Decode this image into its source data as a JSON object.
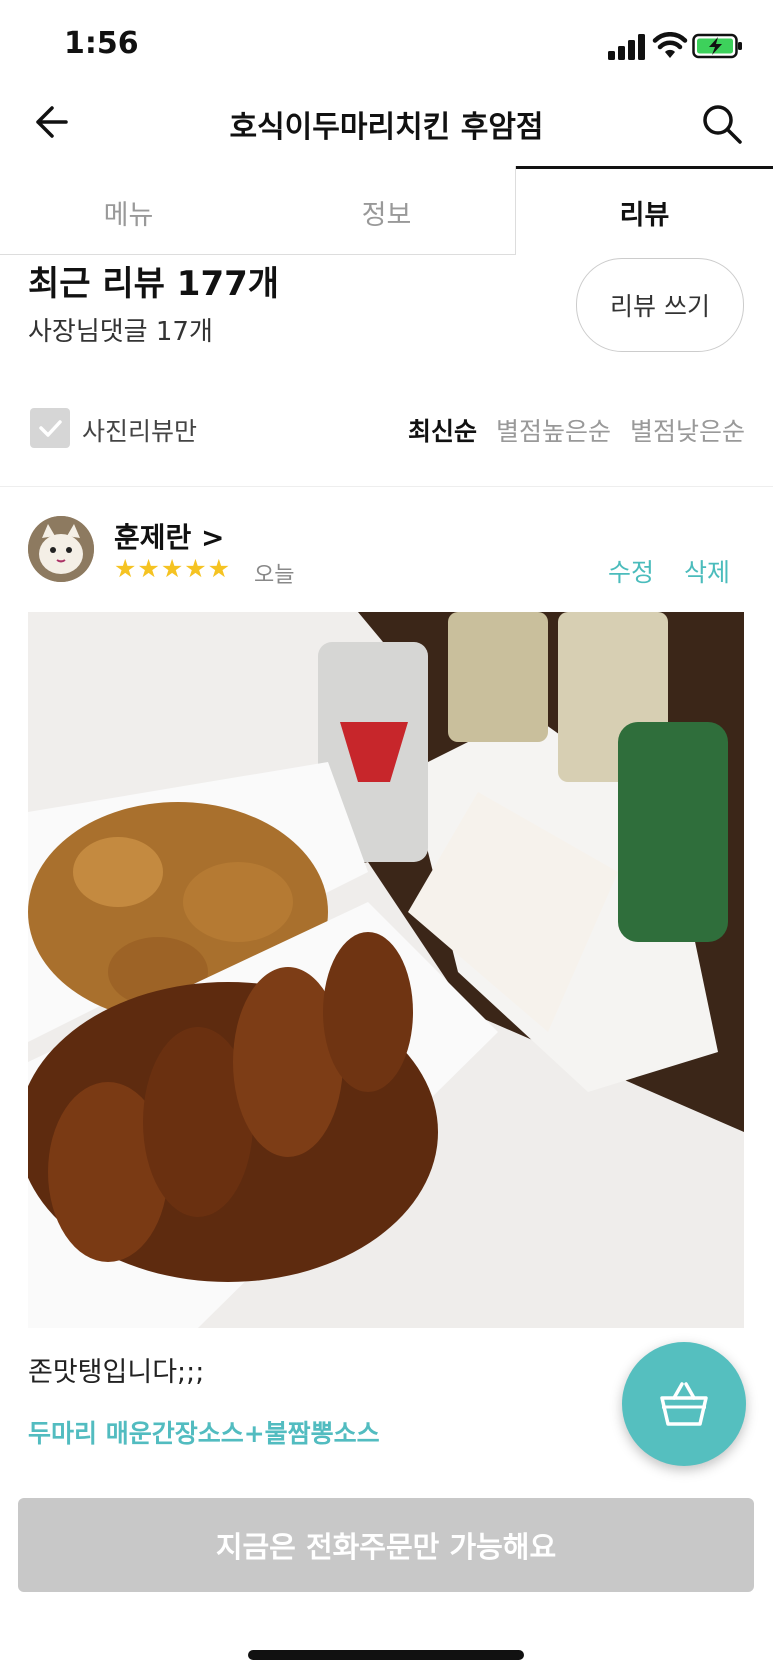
{
  "status_bar": {
    "time": "1:56"
  },
  "header": {
    "title": "호식이두마리치킨 후암점"
  },
  "tabs": [
    {
      "label": "메뉴",
      "active": false
    },
    {
      "label": "정보",
      "active": false
    },
    {
      "label": "리뷰",
      "active": true
    }
  ],
  "summary": {
    "review_count": "최근 리뷰 177개",
    "owner_reply_count": "사장님댓글 17개",
    "write_review_label": "리뷰 쓰기"
  },
  "filter": {
    "photo_only_label": "사진리뷰만",
    "photo_only_checked": false,
    "sort_options": [
      "최신순",
      "별점높은순",
      "별점낮은순"
    ],
    "active_sort": "최신순"
  },
  "review": {
    "reviewer": "훈제란 >",
    "rating": 5,
    "stars": "★★★★★",
    "date": "오늘",
    "edit_label": "수정",
    "delete_label": "삭제",
    "text": "존맛탱입니다;;;",
    "menu": "두마리 매운간장소스+불짬뽕소스"
  },
  "order_bar": {
    "label": "지금은 전화주문만 가능해요"
  },
  "colors": {
    "accent": "#4bbcbc",
    "star": "#f5c322",
    "disabled": "#c8c8c8"
  }
}
